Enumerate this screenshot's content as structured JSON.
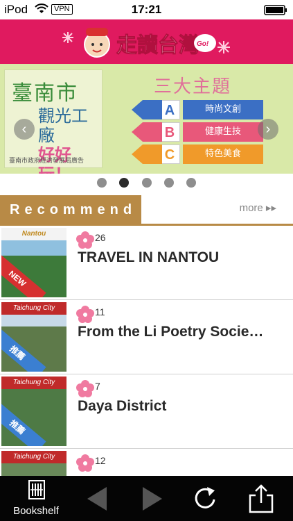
{
  "status_bar": {
    "carrier": "iPod",
    "vpn": "VPN",
    "time": "17:21"
  },
  "header": {
    "logo_text": "走讀台灣",
    "logo_badge": "Free Go!"
  },
  "banner": {
    "left_title": "臺南市",
    "left_line1": "觀光工廠",
    "left_line2": "好好玩！",
    "left_footer": "臺南市政府經濟發展局廣告",
    "right_title": "三大主題",
    "options": [
      {
        "letter": "A",
        "label": "時尚文創",
        "color": "#3b6fc4"
      },
      {
        "letter": "B",
        "label": "健康生技",
        "color": "#e8587a"
      },
      {
        "letter": "C",
        "label": "特色美食",
        "color": "#f09a2a"
      }
    ],
    "prev_symbol": "‹",
    "next_symbol": "›"
  },
  "pager": {
    "count": 5,
    "active_index": 1
  },
  "recommend": {
    "title": "Recommend",
    "more": "more ▸▸"
  },
  "items": [
    {
      "count": "26",
      "title": "TRAVEL IN NANTOU",
      "thumb_caption": "Nantou",
      "ribbon": "NEW"
    },
    {
      "count": "11",
      "title": "From the Li Poetry Socie…",
      "thumb_caption": "Taichung City",
      "ribbon": "推薦"
    },
    {
      "count": "7",
      "title": "Daya District",
      "thumb_caption": "Taichung City",
      "ribbon": "推薦"
    },
    {
      "count": "12",
      "title": "",
      "thumb_caption": "Taichung City",
      "ribbon": ""
    }
  ],
  "toolbar": {
    "bookshelf": "Bookshelf"
  },
  "colors": {
    "header": "#e01a5f",
    "recommend_bar": "#b88a46",
    "toolbar": "#050505"
  }
}
